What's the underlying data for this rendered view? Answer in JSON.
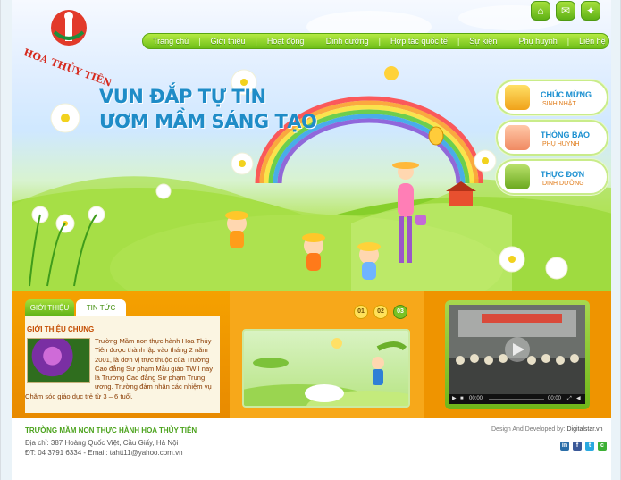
{
  "header": {
    "logo_text": "HOA THỦY TIÊN",
    "top_icons": [
      "home-icon",
      "mail-icon",
      "lightbulb-icon"
    ]
  },
  "nav": {
    "items": [
      "Trang chủ",
      "Giới thiệu",
      "Hoạt động",
      "Dinh dưỡng",
      "Hợp tác quốc tế",
      "Sự kiện",
      "Phụ huynh",
      "Liên hệ"
    ]
  },
  "hero": {
    "slogan_line1": "VUN ĐẮP TỰ TIN",
    "slogan_line2": "ƯƠM MẦM SÁNG TẠO"
  },
  "side_buttons": [
    {
      "title": "CHÚC MỪNG",
      "subtitle": "SINH NHẬT",
      "icon": "gift-icon"
    },
    {
      "title": "THÔNG BÁO",
      "subtitle": "PHỤ HUYNH",
      "icon": "pencil-icon"
    },
    {
      "title": "THỰC ĐƠN",
      "subtitle": "DINH DƯỠNG",
      "icon": "food-bowl-icon"
    }
  ],
  "tabs": {
    "tab1": "GIỚI THIỆU",
    "tab2": "TIN TỨC"
  },
  "intro": {
    "heading": "GIỚI THIỆU CHUNG",
    "text": "Trường Mầm non thực hành Hoa Thủy Tiên  được thành lập vào tháng 2 năm 2001, là đơn vị trực thuộc của Trường Cao đẳng Sư phạm Mẫu giáo TW I nay là Trường Cao đẳng Sư phạm Trung ương. Trường đảm nhận các nhiệm vụ Chăm sóc giáo dục trẻ từ 3 – 6 tuổi."
  },
  "slider": {
    "pages": [
      "01",
      "02",
      "03"
    ],
    "active": "03"
  },
  "video": {
    "time_current": "00:00",
    "time_total": "00:00"
  },
  "footer": {
    "school": "TRƯỜNG MẦM NON THỰC HÀNH HOA THỦY TIÊN",
    "address": "Địa chỉ: 387 Hoàng Quốc Việt, Cầu Giấy, Hà Nội",
    "phone": "ĐT: 04 3791 6334 - Email:  tahtt11@yahoo.com.vn",
    "credit_prefix": "Design And Developed by:",
    "credit_name": "Digitalstar.vn",
    "social": [
      "in",
      "f",
      "t",
      "c"
    ]
  },
  "colors": {
    "green": "#6fbf18",
    "orange": "#f5a100",
    "blue": "#1f8cc7"
  }
}
